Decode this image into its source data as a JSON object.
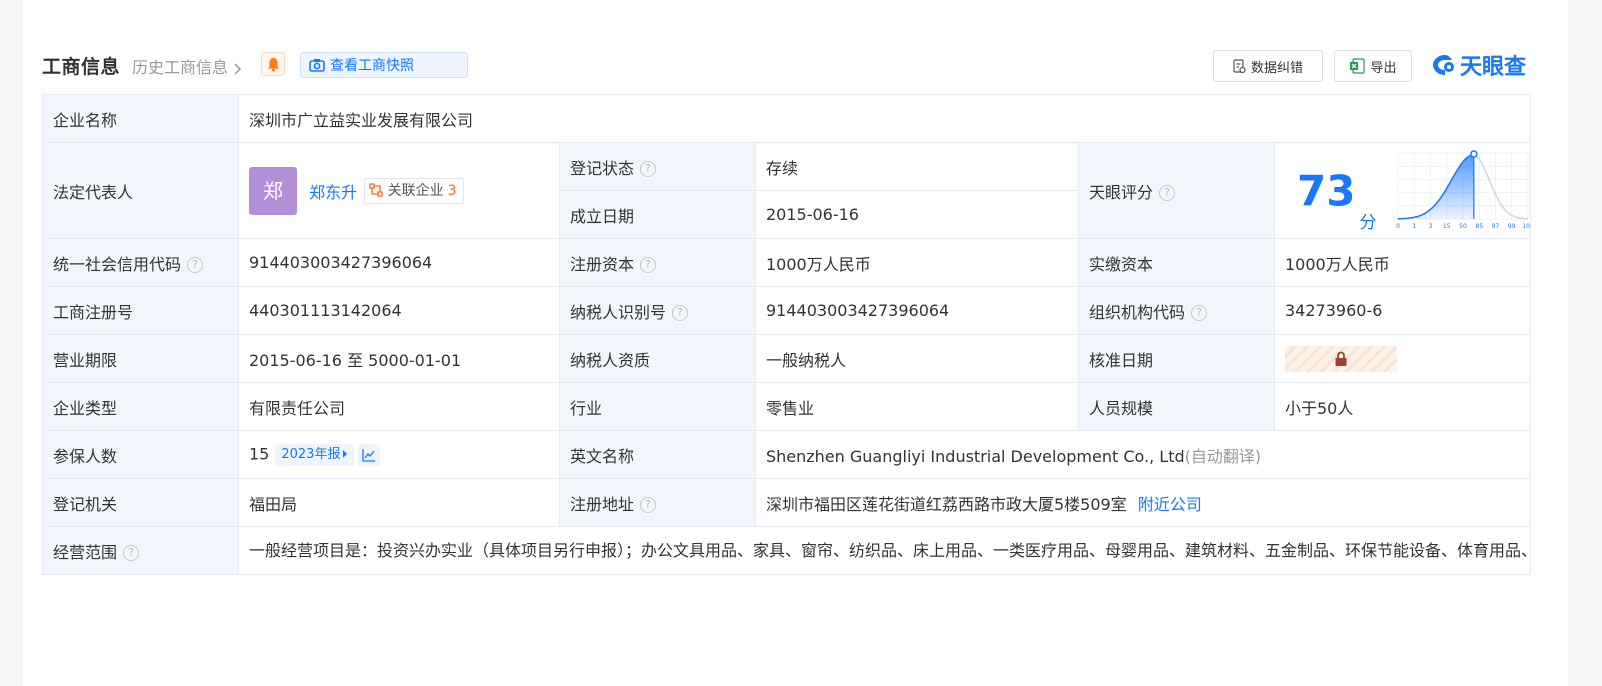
{
  "header": {
    "title": "工商信息",
    "history_link": "历史工商信息",
    "snapshot_button": "查看工商快照",
    "correct_button": "数据纠错",
    "export_button": "导出",
    "logo_text": "天眼查",
    "accent_color": "#1677ff"
  },
  "rows": {
    "company_name_label": "企业名称",
    "company_name": "深圳市广立益实业发展有限公司",
    "legal_rep_label": "法定代表人",
    "legal_rep_avatar": "郑",
    "legal_rep_name": "郑东升",
    "assoc_label": "关联企业",
    "assoc_count": "3",
    "reg_status_label": "登记状态",
    "reg_status": "存续",
    "found_date_label": "成立日期",
    "found_date": "2015-06-16",
    "score_label": "天眼评分",
    "score": "73",
    "score_unit": "分",
    "credit_code_label": "统一社会信用代码",
    "credit_code": "914403003427396064",
    "reg_capital_label": "注册资本",
    "reg_capital": "1000万人民币",
    "paid_capital_label": "实缴资本",
    "paid_capital": "1000万人民币",
    "biz_reg_no_label": "工商注册号",
    "biz_reg_no": "440301113142064",
    "taxpayer_id_label": "纳税人识别号",
    "taxpayer_id": "914403003427396064",
    "org_code_label": "组织机构代码",
    "org_code": "34273960-6",
    "term_label": "营业期限",
    "term": "2015-06-16 至 5000-01-01",
    "taxpayer_qual_label": "纳税人资质",
    "taxpayer_qual": "一般纳税人",
    "approve_date_label": "核准日期",
    "type_label": "企业类型",
    "type": "有限责任公司",
    "industry_label": "行业",
    "industry": "零售业",
    "staff_label": "人员规模",
    "staff": "小于50人",
    "insured_label": "参保人数",
    "insured": "15",
    "insured_year": "2023年报",
    "en_name_label": "英文名称",
    "en_name": "Shenzhen Guangliyi Industrial Development Co., Ltd",
    "en_name_note": "(自动翻译)",
    "authority_label": "登记机关",
    "authority": "福田局",
    "address_label": "注册地址",
    "address": "深圳市福田区莲花街道红荔西路市政大厦5楼509室",
    "nearby_link": "附近公司",
    "scope_label": "经营范围",
    "scope": "一般经营项目是：投资兴办实业（具体项目另行申报）；办公文具用品、家具、窗帘、纺织品、床上用品、一类医疗用品、母婴用品、建筑材料、五金制品、环保节能设备、体育用品、机电设备、电子产品、电器、通讯器材、包装材料、化工产品（不含危险化学品）、日用百货的购销；建筑工程服务；信息咨询服务；国内贸易；经营进出口业务。（法律、行政法规、国务院决定禁止的项目除外，限制的项目须取得许可后方可经营）新型环保洁净建筑装饰材料的购销、设计、上门安装。，许可经营项目是：无"
  },
  "score_chart": {
    "ticks": [
      "0",
      "1",
      "3",
      "15",
      "50",
      "85",
      "97",
      "99",
      "100"
    ],
    "marker_value": 73
  },
  "colors": {
    "label_bg": "#f1f6fd",
    "status_green": "#24a044",
    "avatar_bg": "#b28fd6"
  }
}
